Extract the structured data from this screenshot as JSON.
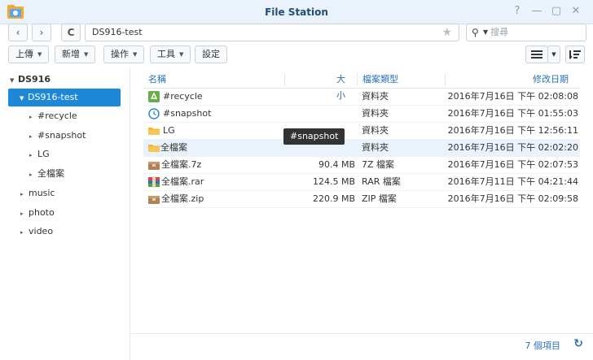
{
  "window": {
    "title": "File Station",
    "controls": [
      "?",
      "—",
      "▢",
      "✕"
    ]
  },
  "address": {
    "back": "‹",
    "forward": "›",
    "refresh": "C",
    "path": "DS916-test",
    "star": "★",
    "search_placeholder": "搜尋"
  },
  "toolbar": {
    "upload": "上傳",
    "create": "新增",
    "action": "操作",
    "tools": "工具",
    "settings": "設定"
  },
  "sidebar": {
    "root": "DS916",
    "selected": "DS916-test",
    "children": [
      "#recycle",
      "#snapshot",
      "LG",
      "全檔案"
    ],
    "others": [
      "music",
      "photo",
      "video"
    ]
  },
  "list": {
    "columns": {
      "name": "名稱",
      "size": "大小",
      "type": "檔案類型",
      "modified": "修改日期"
    },
    "rows": [
      {
        "name": "#recycle",
        "size": "",
        "type": "資料夾",
        "modified": "2016年7月16日 下午 02:08:08",
        "icon": "recycle-folder-icon"
      },
      {
        "name": "#snapshot",
        "size": "",
        "type": "資料夾",
        "modified": "2016年7月16日 下午 01:55:03",
        "icon": "snapshot-folder-icon"
      },
      {
        "name": "LG",
        "size": "",
        "type": "資料夾",
        "modified": "2016年7月16日 下午 12:56:11",
        "icon": "folder-icon"
      },
      {
        "name": "全檔案",
        "size": "",
        "type": "資料夾",
        "modified": "2016年7月16日 下午 02:02:20",
        "icon": "folder-icon"
      },
      {
        "name": "全檔案.7z",
        "size": "90.4 MB",
        "type": "7Z 檔案",
        "modified": "2016年7月16日 下午 02:07:53",
        "icon": "archive-7z-icon"
      },
      {
        "name": "全檔案.rar",
        "size": "124.5 MB",
        "type": "RAR 檔案",
        "modified": "2016年7月11日 下午 04:21:44",
        "icon": "archive-rar-icon"
      },
      {
        "name": "全檔案.zip",
        "size": "220.9 MB",
        "type": "ZIP 檔案",
        "modified": "2016年7月16日 下午 02:09:58",
        "icon": "archive-zip-icon"
      }
    ]
  },
  "tooltip": "#snapshot",
  "footer": {
    "count": "7 個項目"
  },
  "colors": {
    "accent": "#1e88d8",
    "header_text": "#2b71b8",
    "title_text": "#1f4e79"
  }
}
